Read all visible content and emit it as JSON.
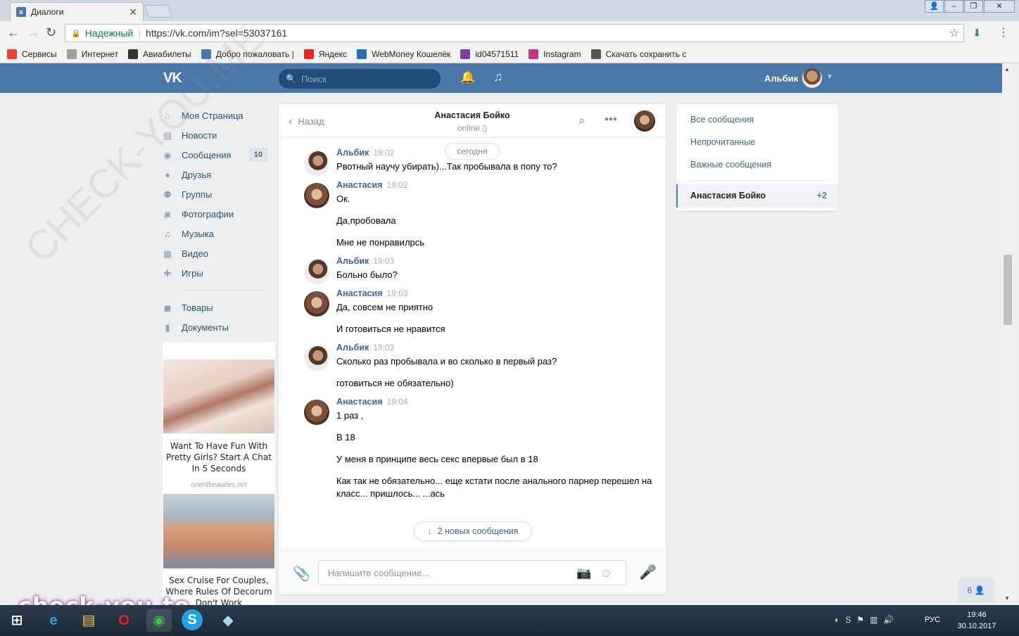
{
  "browser": {
    "tab_title": "Диалоги",
    "secure_label": "Надежный",
    "url": "https://vk.com/im?sel=53037161",
    "bookmarks": [
      {
        "label": "Сервисы",
        "icon": "apps-grid-icon",
        "color": "#e94235"
      },
      {
        "label": "Интернет",
        "icon": "page-icon",
        "color": "#9e9e9e"
      },
      {
        "label": "Авиабилеты",
        "icon": "plane-icon",
        "color": "#333333"
      },
      {
        "label": "Добро пожаловать |",
        "icon": "vk-icon",
        "color": "#4a76a8"
      },
      {
        "label": "Яндекс",
        "icon": "yandex-icon",
        "color": "#e62b1e"
      },
      {
        "label": "WebMoney Кошелёк",
        "icon": "webmoney-icon",
        "color": "#2b6cb5"
      },
      {
        "label": "id04571511",
        "icon": "s-icon",
        "color": "#7a3fa0"
      },
      {
        "label": "Instagram",
        "icon": "instagram-icon",
        "color": "#c13584"
      },
      {
        "label": "Скачать сохранить с",
        "icon": "eye-icon",
        "color": "#555555"
      }
    ]
  },
  "vk": {
    "search_placeholder": "Поиск",
    "user_name": "Альбик"
  },
  "left_menu": {
    "items": [
      {
        "label": "Моя Страница",
        "icon": "home-icon",
        "glyph": "⌂",
        "count": ""
      },
      {
        "label": "Новости",
        "icon": "news-icon",
        "glyph": "▤",
        "count": ""
      },
      {
        "label": "Сообщения",
        "icon": "messages-icon",
        "glyph": "◉",
        "count": "10"
      },
      {
        "label": "Друзья",
        "icon": "friend-icon",
        "glyph": "●",
        "count": ""
      },
      {
        "label": "Группы",
        "icon": "groups-icon",
        "glyph": "⚉",
        "count": ""
      },
      {
        "label": "Фотографии",
        "icon": "camera-icon",
        "glyph": "◙",
        "count": ""
      },
      {
        "label": "Музыка",
        "icon": "music-icon",
        "glyph": "♫",
        "count": ""
      },
      {
        "label": "Видео",
        "icon": "video-icon",
        "glyph": "▦",
        "count": ""
      },
      {
        "label": "Игры",
        "icon": "gamepad-icon",
        "glyph": "✚",
        "count": ""
      }
    ],
    "items2": [
      {
        "label": "Товары",
        "icon": "bag-icon",
        "glyph": "◼"
      },
      {
        "label": "Документы",
        "icon": "document-icon",
        "glyph": "▮"
      }
    ]
  },
  "ads": {
    "ad1_text": "Want To Have Fun With Pretty Girls? Start A Chat In 5 Seconds",
    "ad1_source": "orientbeauties.net",
    "ad2_text": "Sex Cruise For Couples, Where Rules Of Decorum Don't Work"
  },
  "chat": {
    "back_label": "Назад",
    "peer_name": "Анастасия Бойко",
    "peer_status": "online",
    "date_divider": "сегодня",
    "new_messages_label": "2 новых сообщения",
    "input_placeholder": "Напишите сообщение...",
    "messages": [
      {
        "author": "Альбик",
        "time": "19:02",
        "avatar": "m",
        "lines": [
          "Рвотный научу убирать)...Так пробывала в попу то?"
        ]
      },
      {
        "author": "Анастасия",
        "time": "19:02",
        "avatar": "f",
        "lines": [
          "Ок.",
          "Да,пробовала",
          "Мне не понравилрсь"
        ]
      },
      {
        "author": "Альбик",
        "time": "19:03",
        "avatar": "m",
        "lines": [
          "Больно было?"
        ]
      },
      {
        "author": "Анастасия",
        "time": "19:03",
        "avatar": "f",
        "lines": [
          "Да, совсем не приятно",
          "И готовиться не нравится"
        ]
      },
      {
        "author": "Альбик",
        "time": "19:03",
        "avatar": "m",
        "lines": [
          "Сколько раз пробывала и во сколько в первый раз?",
          "готовиться не обязательно)"
        ]
      },
      {
        "author": "Анастасия",
        "time": "19:04",
        "avatar": "f",
        "lines": [
          "1 раз ,",
          "В 18",
          "У меня в принципе весь секс впервые был в 18",
          "Как так не обязательно... еще кстати после анального парнер перешел на класс... пришлось... ...ась"
        ]
      }
    ]
  },
  "filters": {
    "all": "Все сообщения",
    "unread": "Непрочитанные",
    "important": "Важные сообщения",
    "selected_name": "Анастасия Бойко",
    "selected_count": "+2"
  },
  "online_friends": "6",
  "watermark": {
    "diagonal": "CHECK-YOU.ME",
    "bottom": "check-you.to"
  },
  "taskbar": {
    "lang": "РУС",
    "time": "19:46",
    "date": "30.10.2017"
  }
}
